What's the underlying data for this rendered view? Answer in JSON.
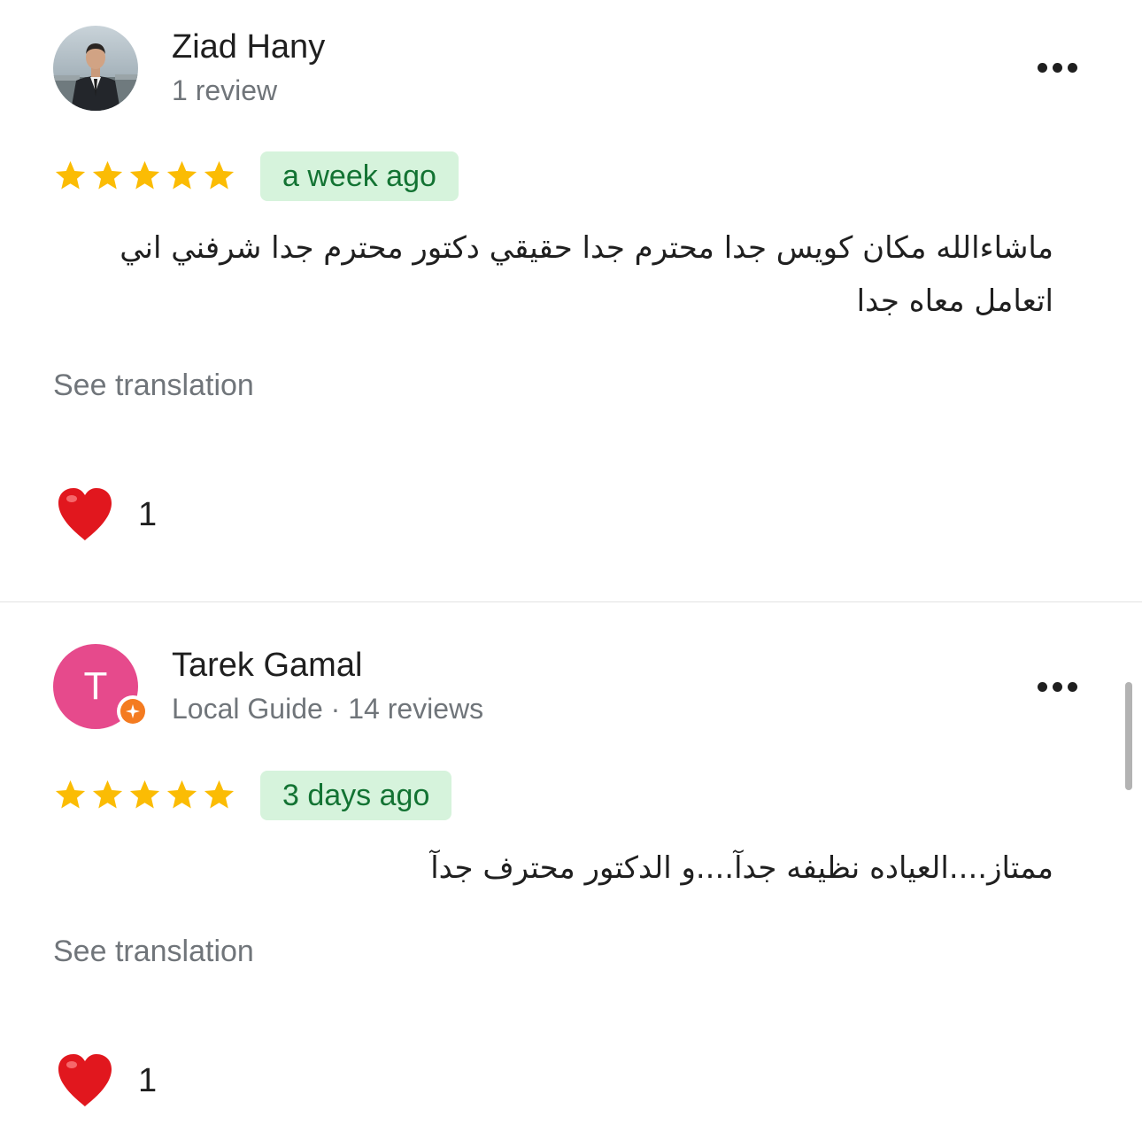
{
  "colors": {
    "star": "#fbbc04",
    "time_badge_bg": "#d6f3dc",
    "time_badge_text": "#137333",
    "secondary_text": "#70757a",
    "heart": "#e1171e",
    "avatar_letter_bg": "#e64a8c",
    "local_guide_badge": "#f47b20"
  },
  "reviews": [
    {
      "author": "Ziad Hany",
      "meta": "1 review",
      "avatar_type": "photo",
      "rating": 5,
      "time": "a week ago",
      "text": "ماشاءالله مكان كويس جدا محترم جدا حقيقي دكتور محترم جدا شرفني اني اتعامل معاه جدا",
      "see_translation": "See translation",
      "reaction_icon": "heart-icon",
      "reaction_count": "1",
      "more_icon": "more-horizontal-icon"
    },
    {
      "author": "Tarek Gamal",
      "meta": "Local Guide · 14 reviews",
      "avatar_type": "letter",
      "avatar_letter": "T",
      "badge_icon": "local-guide-badge-icon",
      "rating": 5,
      "time": "3 days ago",
      "text": "ممتاز....العياده نظيفه جدآ....و الدكتور محترف جدآ",
      "see_translation": "See translation",
      "reaction_icon": "heart-icon",
      "reaction_count": "1",
      "more_icon": "more-horizontal-icon"
    }
  ]
}
